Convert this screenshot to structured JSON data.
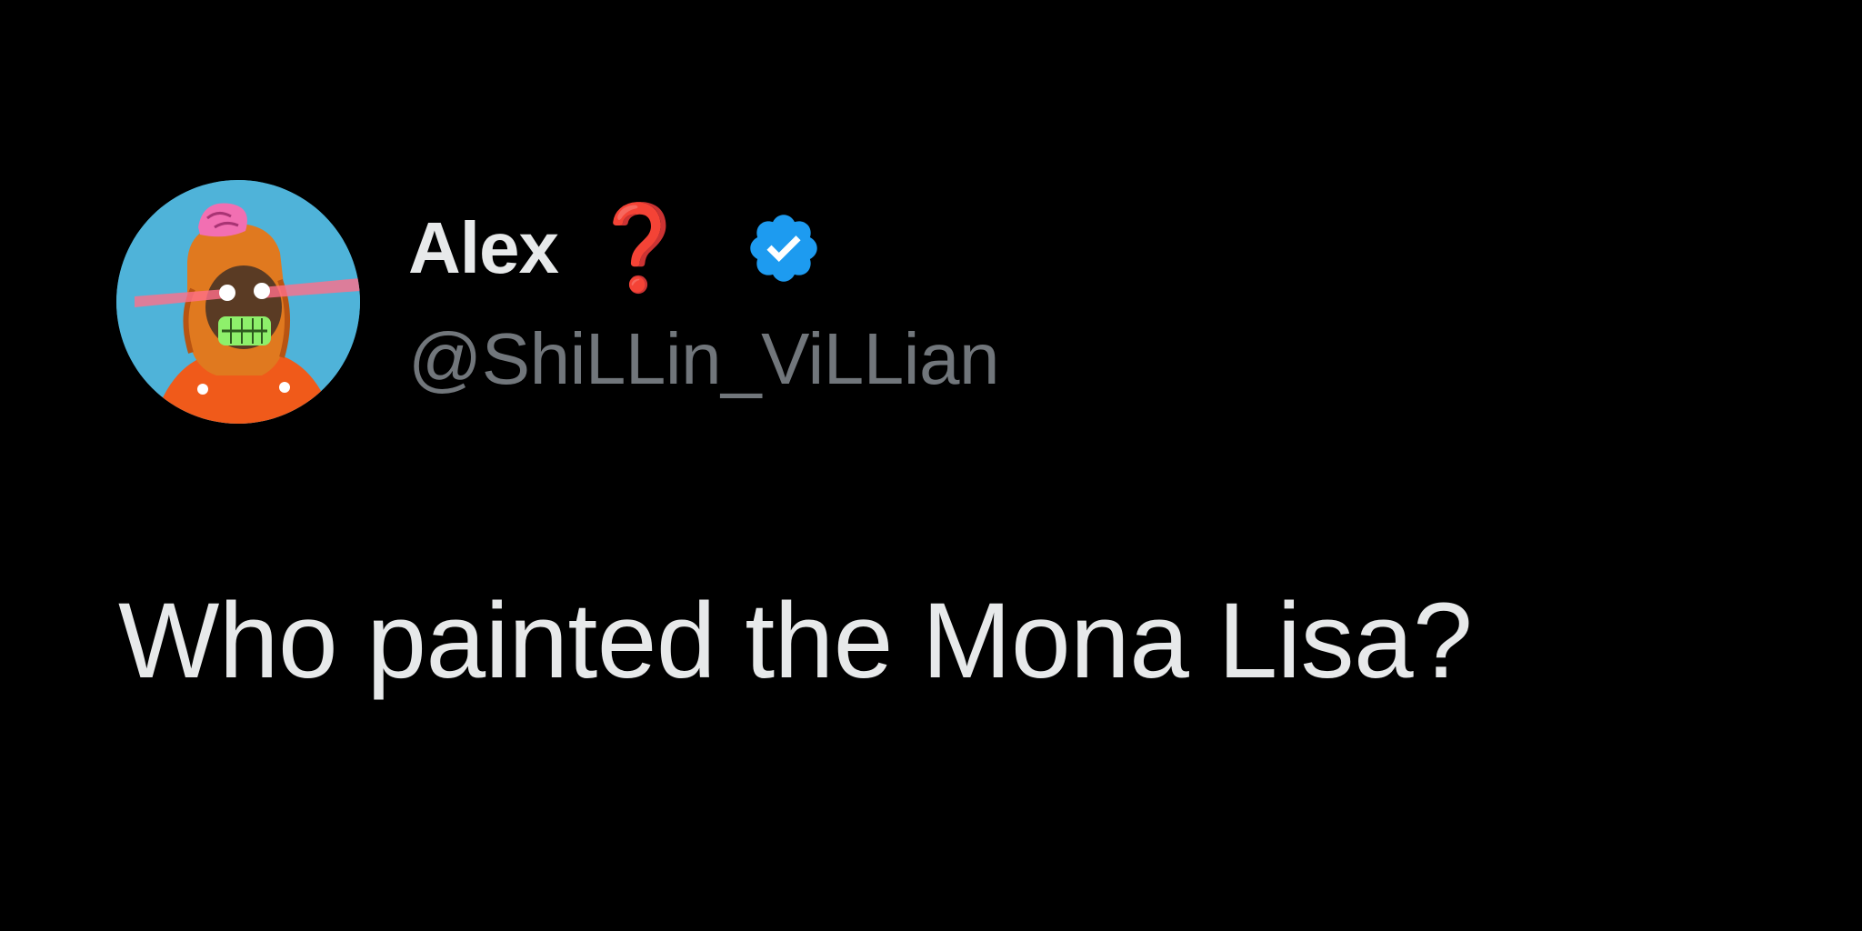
{
  "colors": {
    "background": "#000000",
    "primary_text": "#e7e9ea",
    "secondary_text": "#71767b",
    "verified_badge": "#1d9bf0",
    "question_mark": "#e0141e",
    "avatar_background": "#4fb3d9"
  },
  "author": {
    "display_name": "Alex",
    "name_emoji": "❓",
    "handle": "@ShiLLin_ViLLian",
    "avatar_icon": "ape-nft-avatar",
    "verified_icon": "verified-badge-icon"
  },
  "tweet": {
    "text": "Who painted the Mona Lisa?"
  }
}
